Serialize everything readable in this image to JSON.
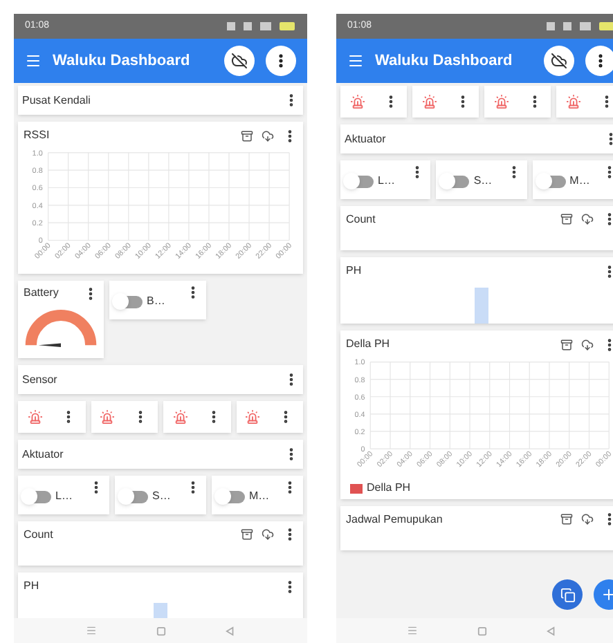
{
  "screens": [
    {
      "status_bar": {
        "time": "01:08"
      },
      "app_bar": {
        "title": "Waluku Dashboard"
      },
      "widgets": [
        {
          "kind": "title",
          "label": "Pusat Kendali"
        },
        {
          "kind": "chart",
          "label": "RSSI",
          "chart_data": {
            "type": "line",
            "ylim": [
              0,
              1
            ],
            "grid": true,
            "categories": [
              "00:00",
              "02:00",
              "04:00",
              "06:00",
              "08:00",
              "10:00",
              "12:00",
              "14:00",
              "16:00",
              "18:00",
              "20:00",
              "22:00",
              "00:00"
            ],
            "yticks": [
              {
                "value": 0,
                "label": "0"
              },
              {
                "value": 0.2,
                "label": "0.2"
              },
              {
                "value": 0.4,
                "label": "0.4"
              },
              {
                "value": 0.6,
                "label": "0.6"
              },
              {
                "value": 0.8,
                "label": "0.8"
              },
              {
                "value": 1,
                "label": "1.0"
              }
            ]
          }
        },
        {
          "kind": "row",
          "items": [
            {
              "kind": "gauge",
              "label": "Battery"
            },
            {
              "kind": "switch",
              "label": "B…",
              "on": false
            }
          ]
        },
        {
          "kind": "title",
          "label": "Sensor"
        },
        {
          "kind": "row",
          "items": [
            {
              "kind": "lamp"
            },
            {
              "kind": "lamp"
            },
            {
              "kind": "lamp"
            },
            {
              "kind": "lamp"
            }
          ]
        },
        {
          "kind": "title",
          "label": "Aktuator"
        },
        {
          "kind": "row",
          "items": [
            {
              "kind": "switch",
              "label": "L…",
              "on": false
            },
            {
              "kind": "switch",
              "label": "S…",
              "on": false
            },
            {
              "kind": "switch",
              "label": "M…",
              "on": false
            }
          ]
        },
        {
          "kind": "card",
          "label": "Count"
        },
        {
          "kind": "bar",
          "label": "PH"
        }
      ]
    },
    {
      "status_bar": {
        "time": "01:08"
      },
      "app_bar": {
        "title": "Waluku Dashboard"
      },
      "fab": true,
      "widgets": [
        {
          "kind": "row",
          "items": [
            {
              "kind": "lamp"
            },
            {
              "kind": "lamp"
            },
            {
              "kind": "lamp"
            },
            {
              "kind": "lamp"
            }
          ]
        },
        {
          "kind": "title",
          "label": "Aktuator"
        },
        {
          "kind": "row",
          "items": [
            {
              "kind": "switch",
              "label": "L…",
              "on": false
            },
            {
              "kind": "switch",
              "label": "S…",
              "on": false
            },
            {
              "kind": "switch",
              "label": "M…",
              "on": false
            }
          ]
        },
        {
          "kind": "card",
          "label": "Count"
        },
        {
          "kind": "bar",
          "label": "PH"
        },
        {
          "kind": "chart",
          "label": "Della PH",
          "chart_data": {
            "type": "line",
            "ylim": [
              0,
              1
            ],
            "grid": true,
            "categories": [
              "00:00",
              "02:00",
              "04:00",
              "06:00",
              "08:00",
              "10:00",
              "12:00",
              "14:00",
              "16:00",
              "18:00",
              "20:00",
              "22:00",
              "00:00"
            ],
            "yticks": [
              {
                "value": 0,
                "label": "0"
              },
              {
                "value": 0.2,
                "label": "0.2"
              },
              {
                "value": 0.4,
                "label": "0.4"
              },
              {
                "value": 0.6,
                "label": "0.6"
              },
              {
                "value": 0.8,
                "label": "0.8"
              },
              {
                "value": 1,
                "label": "1.0"
              }
            ],
            "series": [
              {
                "name": "Della PH",
                "color": "#e05252",
                "values": [
                  null,
                  null,
                  null,
                  null,
                  null,
                  null,
                  null,
                  null,
                  null,
                  null,
                  null,
                  null,
                  null
                ]
              }
            ]
          }
        },
        {
          "kind": "card",
          "label": "Jadwal Pemupukan"
        }
      ]
    }
  ]
}
